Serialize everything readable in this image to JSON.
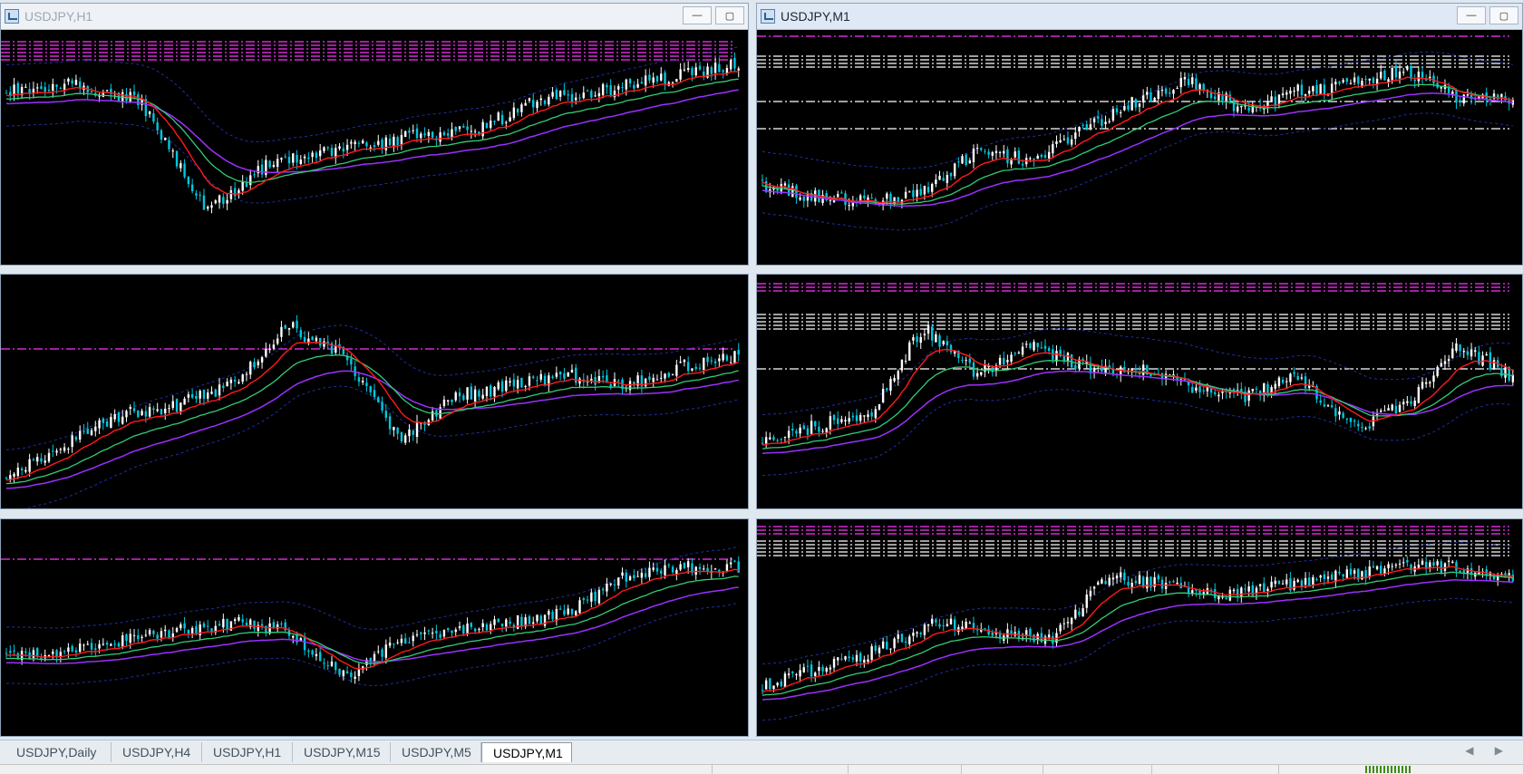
{
  "windows": [
    {
      "title": "USDJPY,H1",
      "active": false
    },
    {
      "title": "USDJPY,M1",
      "active": true
    }
  ],
  "window_buttons": {
    "minimize": "—",
    "maximize": "▢"
  },
  "tabs": [
    "USDJPY,Daily",
    "USDJPY,H4",
    "USDJPY,H1",
    "USDJPY,M15",
    "USDJPY,M5",
    "USDJPY,M1"
  ],
  "active_tab": "USDJPY,M1",
  "tab_scroll": "◀ ▶",
  "colors": {
    "background": "#000000",
    "candle_up": "#ffffff",
    "candle_down": "#00c8e0",
    "ma_fast": "#ff1a1a",
    "ma_mid": "#33cc77",
    "ma_slow": "#9b30ff",
    "bollinger": "#1f2fa0",
    "level_magenta": "#ff33ff",
    "level_white": "#ffffff"
  },
  "icons": {
    "window": "chart-window-icon",
    "signal": "signal-bars-icon"
  }
}
